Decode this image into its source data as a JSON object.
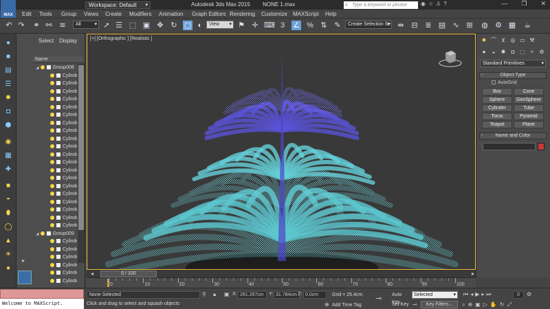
{
  "app": {
    "logo_text": "MAX",
    "title": "Autodesk 3ds Max  2015",
    "filename": "NONE 1.max",
    "workspace": "Workspace: Default",
    "search_placeholder": "Type a keyword or phrase"
  },
  "menu": [
    "Edit",
    "Tools",
    "Group",
    "Views",
    "Create",
    "Modifiers",
    "Animation",
    "Graph Editors",
    "Rendering",
    "Customize",
    "MAXScript",
    "Help"
  ],
  "toolbar": {
    "filter": "All",
    "ref_coord": "View",
    "selection_set": "Create Selection Se"
  },
  "explorer": {
    "tab_select": "Select",
    "tab_display": "Display",
    "column_name": "Name",
    "groups": [
      {
        "name": "Group008",
        "children": [
          "Cylinder",
          "Cylinder",
          "Cylinder",
          "Cylinder",
          "Cylinder",
          "Cylinder",
          "Cylinder",
          "Cylinder",
          "Cylinder",
          "Cylinder",
          "Cylinder",
          "Cylinder",
          "Cylinder",
          "Cylinder",
          "Cylinder",
          "Cylinder",
          "Cylinder",
          "Cylinder",
          "Cylinder",
          "Cylinder"
        ]
      },
      {
        "name": "Group009",
        "children": [
          "Cylinder",
          "Cylinder",
          "Cylinder",
          "Cylinder",
          "Cylinder",
          "Cylinder"
        ]
      }
    ]
  },
  "viewport": {
    "label": "[+] [Orthographic ] [Realistic ]"
  },
  "command_panel": {
    "category": "Standard Primitives",
    "object_type_title": "Object Type",
    "autogrid": "AutoGrid",
    "primitives": [
      "Box",
      "Cone",
      "Sphere",
      "GeoSphere",
      "Cylinder",
      "Tube",
      "Torus",
      "Pyramid",
      "Teapot",
      "Plane"
    ],
    "name_color_title": "Name and Color",
    "color": "#c83939"
  },
  "timeline": {
    "slider": "0 / 100",
    "ticks": [
      "0",
      "10",
      "20",
      "30",
      "40",
      "50",
      "60",
      "70",
      "80",
      "90",
      "100"
    ]
  },
  "status": {
    "maxscript_line": "Welcome to MAXScript.",
    "selection": "None Selected",
    "prompt": "Click and drag to select and squash objects",
    "x_label": "X:",
    "x_val": "261.267cm",
    "y_label": "Y:",
    "y_val": "31.784cm",
    "z_label": "Z:",
    "z_val": "0.0cm",
    "grid": "Grid = 25.4cm",
    "add_time_tag": "Add Time Tag",
    "auto_key": "Auto Key",
    "set_key": "Set Key",
    "key_mode": "Selected",
    "key_filters": "Key Filters...",
    "frame": "0"
  },
  "colors": {
    "wire_cyan": "#6fd8e0",
    "wire_purple": "#5a52d8",
    "viewport_border": "#f0c040"
  }
}
